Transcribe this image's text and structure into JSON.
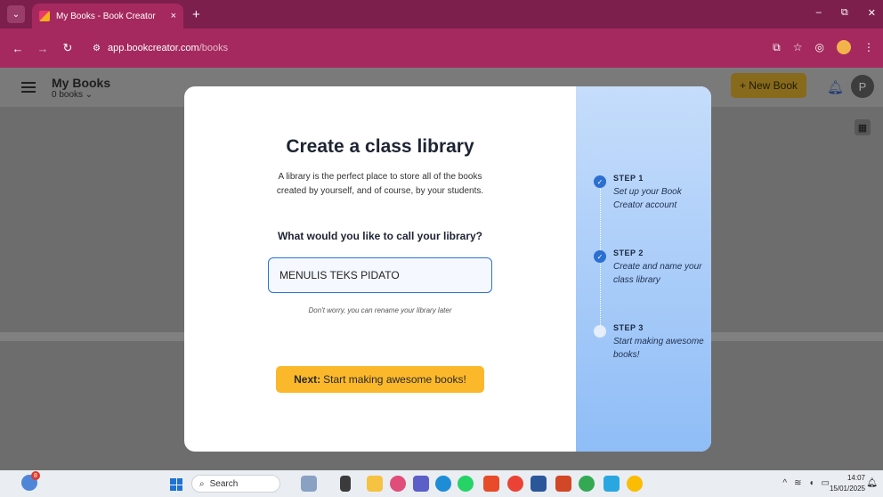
{
  "browser": {
    "tab_title": "My Books - Book Creator",
    "tab_close": "×",
    "new_tab": "+",
    "url_host": "app.bookcreator.com",
    "url_path": "/books",
    "window_controls": [
      "–",
      "⧉",
      "✕"
    ]
  },
  "app": {
    "title": "My Books",
    "subtitle": "0 books ⌄",
    "new_book_label": "+ New Book",
    "avatar_initial": "P"
  },
  "modal": {
    "title": "Create a class library",
    "description": "A library is the perfect place to store all of the books created by yourself, and of course, by your students.",
    "question": "What would you like to call your library?",
    "library_name_value": "MENULIS TEKS PIDATO",
    "rename_note": "Don't worry, you can rename your library later",
    "next_label_bold": "Next:",
    "next_label_rest": "Start making awesome books!"
  },
  "steps": [
    {
      "label": "STEP 1",
      "text": "Set up your Book Creator account",
      "done": true
    },
    {
      "label": "STEP 2",
      "text": "Create and name your class library",
      "done": true
    },
    {
      "label": "STEP 3",
      "text": "Start making awesome books!",
      "done": false
    }
  ],
  "taskbar": {
    "weather_badge": "8",
    "search_label": "Search",
    "time": "14:07",
    "date": "15/01/2025"
  },
  "colors": {
    "browser_tabbar": "#7d1f4d",
    "browser_addrbar": "#a5295e",
    "accent_blue": "#2b72d6",
    "next_button": "#fbb82a"
  }
}
